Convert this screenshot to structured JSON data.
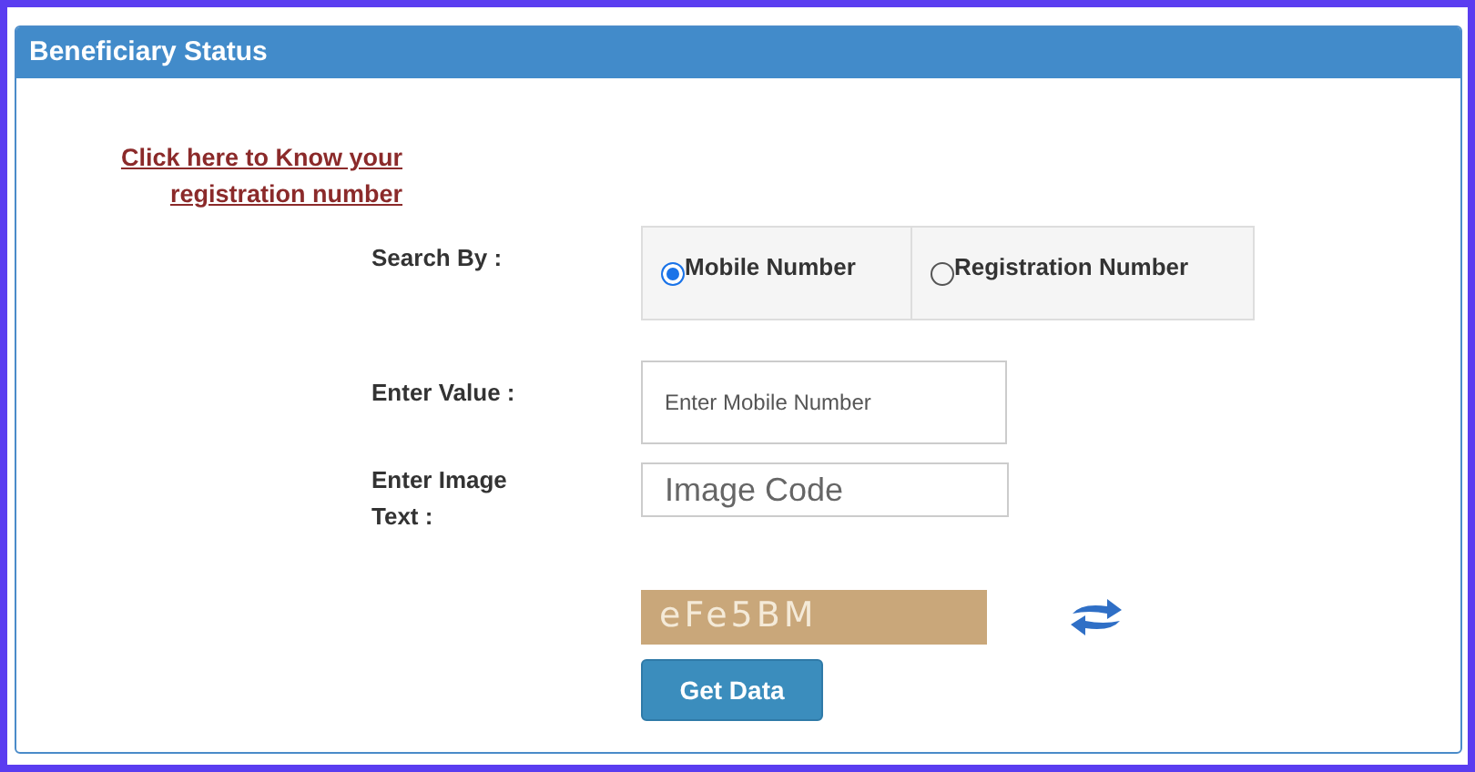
{
  "panel": {
    "title": "Beneficiary Status"
  },
  "help_link": "Click here to Know your registration number",
  "search_by": {
    "label": "Search By :",
    "options": [
      {
        "label": "Mobile Number",
        "selected": true
      },
      {
        "label": "Registration Number",
        "selected": false
      }
    ]
  },
  "value_field": {
    "label": "Enter Value :",
    "placeholder": "Enter Mobile Number"
  },
  "image_field": {
    "label": "Enter Image Text :",
    "placeholder": "Image Code"
  },
  "captcha": {
    "text": "eFe5BM"
  },
  "submit_button": "Get Data"
}
